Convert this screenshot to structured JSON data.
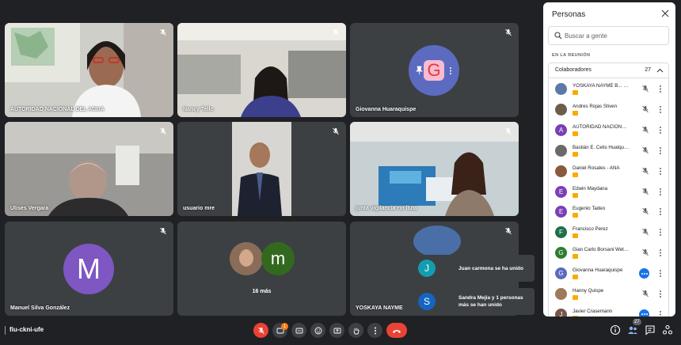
{
  "meeting": {
    "code": "fiu-ckni-ufe"
  },
  "tiles": [
    {
      "name": "AUTORIDAD NACIONAL DEL AGUA"
    },
    {
      "name": "Nancy Tello"
    },
    {
      "name": "Giovanna Huaraquispe",
      "initial": "G"
    },
    {
      "name": "Ulises Vergara"
    },
    {
      "name": "usuario mre"
    },
    {
      "name": "junta vigilancia rio lluta"
    },
    {
      "name": "Manuel Silva González",
      "initial": "M"
    },
    {
      "more_label": "16 más",
      "initial": "m"
    },
    {
      "name": "YOSKAYA NAYME B"
    }
  ],
  "sidebar": {
    "title": "Personas",
    "search_placeholder": "Buscar a gente",
    "section_label": "EN LA REUNIÓN",
    "group_label": "Colaboradores",
    "group_count": "27",
    "participants": [
      {
        "name": "YOSKAYA NAYME B... (Tú)",
        "initial": "",
        "color": "#5b7aa8"
      },
      {
        "name": "Andres Rojas Stiven",
        "initial": "",
        "color": "#6d5d4b"
      },
      {
        "name": "AUTORIDAD NACIONAL...",
        "initial": "A",
        "color": "#7b3fb5"
      },
      {
        "name": "Bastián E. Celis Hualquilaf",
        "initial": "",
        "color": "#6a6a6a"
      },
      {
        "name": "Daniel Rosales - ANA",
        "initial": "",
        "color": "#8a5a3c"
      },
      {
        "name": "Edwin Maydana",
        "initial": "E",
        "color": "#7b3fb5"
      },
      {
        "name": "Eugenio Tadeo",
        "initial": "E",
        "color": "#7b3fb5"
      },
      {
        "name": "Francisco Perez",
        "initial": "F",
        "color": "#1e6f4a"
      },
      {
        "name": "Gian Carlo Borsani Wetz...",
        "initial": "G",
        "color": "#2e7d32"
      },
      {
        "name": "Giovanna Huaraquispe",
        "initial": "G",
        "color": "#5c6bc0"
      },
      {
        "name": "Hanny Quispe",
        "initial": "",
        "color": "#9c7a5a"
      },
      {
        "name": "Javier Crasemann",
        "initial": "J",
        "color": "#795548"
      }
    ]
  },
  "toasts": [
    {
      "text": "Juan carmona se ha unido",
      "initial": "J",
      "color": "#129eaf"
    },
    {
      "text": "Sandra Mejia y 1 personas más se han unido",
      "initial": "S",
      "color": "#1565c0"
    }
  ],
  "toolbar": {
    "chat_count": "1",
    "people_count": "27"
  },
  "colors": {
    "background": "#202124",
    "tile": "#3c4043",
    "accent": "#1a73e8",
    "danger": "#ea4335"
  }
}
